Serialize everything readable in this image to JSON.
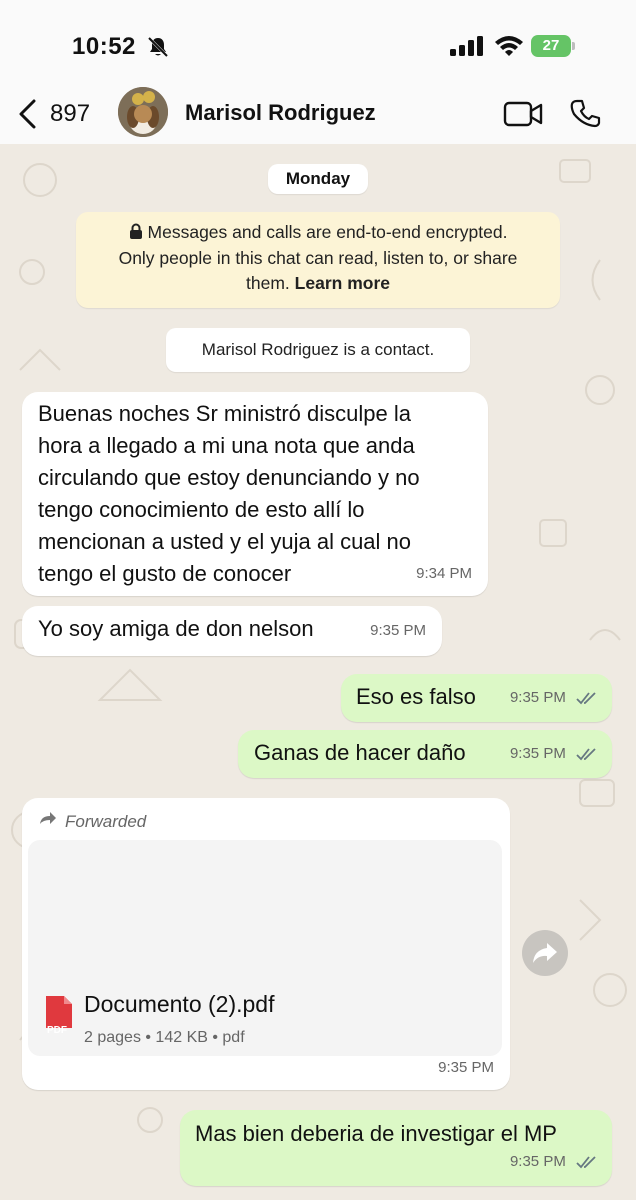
{
  "status_bar": {
    "time": "10:52",
    "battery": "27"
  },
  "header": {
    "back_count": "897",
    "contact_name": "Marisol Rodriguez"
  },
  "chat": {
    "day_label": "Monday",
    "encryption": {
      "line1": "Messages and calls are end-to-end encrypted.",
      "line2": "Only people in this chat can read, listen to, or share",
      "line3": "them.",
      "link": "Learn more"
    },
    "contact_note": "Marisol Rodriguez is a contact.",
    "messages": [
      {
        "direction": "in",
        "lines": [
          "Buenas noches Sr ministró disculpe la",
          "hora a llegado a mi una nota que anda",
          "circulando que estoy denunciando y no",
          "tengo conocimiento de esto allí lo",
          "mencionan a usted y el yuja al cual no",
          "tengo el gusto de conocer"
        ],
        "time": "9:34 PM"
      },
      {
        "direction": "in",
        "text": "Yo soy amiga de don nelson",
        "time": "9:35 PM"
      },
      {
        "direction": "out",
        "text": "Eso es falso",
        "time": "9:35 PM"
      },
      {
        "direction": "out",
        "text": "Ganas de hacer daño",
        "time": "9:35 PM"
      },
      {
        "direction": "in",
        "forwarded_label": "Forwarded",
        "document": {
          "name": "Documento (2).pdf",
          "meta": "2 pages • 142 KB • pdf",
          "icon_text": "PDF"
        },
        "time": "9:35 PM"
      },
      {
        "direction": "out",
        "text": "Mas bien deberia de investigar el MP",
        "time": "9:35 PM"
      }
    ]
  },
  "colors": {
    "incoming": "#ffffff",
    "outgoing": "#dcf8c6",
    "background": "#efeae2",
    "read_ticks": "#667781",
    "pdf_red": "#e0393e",
    "battery_green": "#65c466"
  },
  "icons": [
    "bell-slash-icon",
    "signal-icon",
    "wifi-icon",
    "battery-icon",
    "back-chevron-icon",
    "video-call-icon",
    "phone-icon",
    "lock-icon",
    "forward-arrow-icon",
    "pdf-icon",
    "share-icon",
    "double-check-icon"
  ]
}
